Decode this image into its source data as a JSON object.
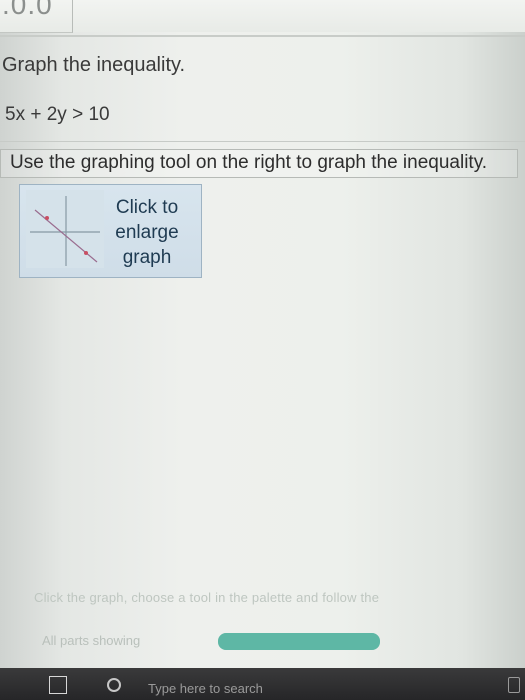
{
  "header": {
    "score_partial": ".0.0"
  },
  "question": {
    "prompt": "Graph the inequality.",
    "inequality": "5x + 2y > 10"
  },
  "instruction": {
    "text": "Use the graphing tool on the right to graph the inequality."
  },
  "graph_button": {
    "line1": "Click to",
    "line2": "enlarge",
    "line3": "graph",
    "thumbnail_icon": "graph-thumbnail-icon"
  },
  "footer": {
    "note": "Click the graph, choose a tool in the palette and follow the",
    "status": "All parts showing",
    "progress": 1
  },
  "taskbar": {
    "start_icon": "windows-icon",
    "search_icon": "search-icon",
    "search_placeholder": "Type here to search",
    "right_icon": "system-icon"
  },
  "colors": {
    "background": "#eef0ed",
    "button_fill": "#d8e5ee",
    "button_text": "#1f3b52",
    "progress_fill": "#5eb7a5",
    "taskbar": "#2d2d2f"
  }
}
